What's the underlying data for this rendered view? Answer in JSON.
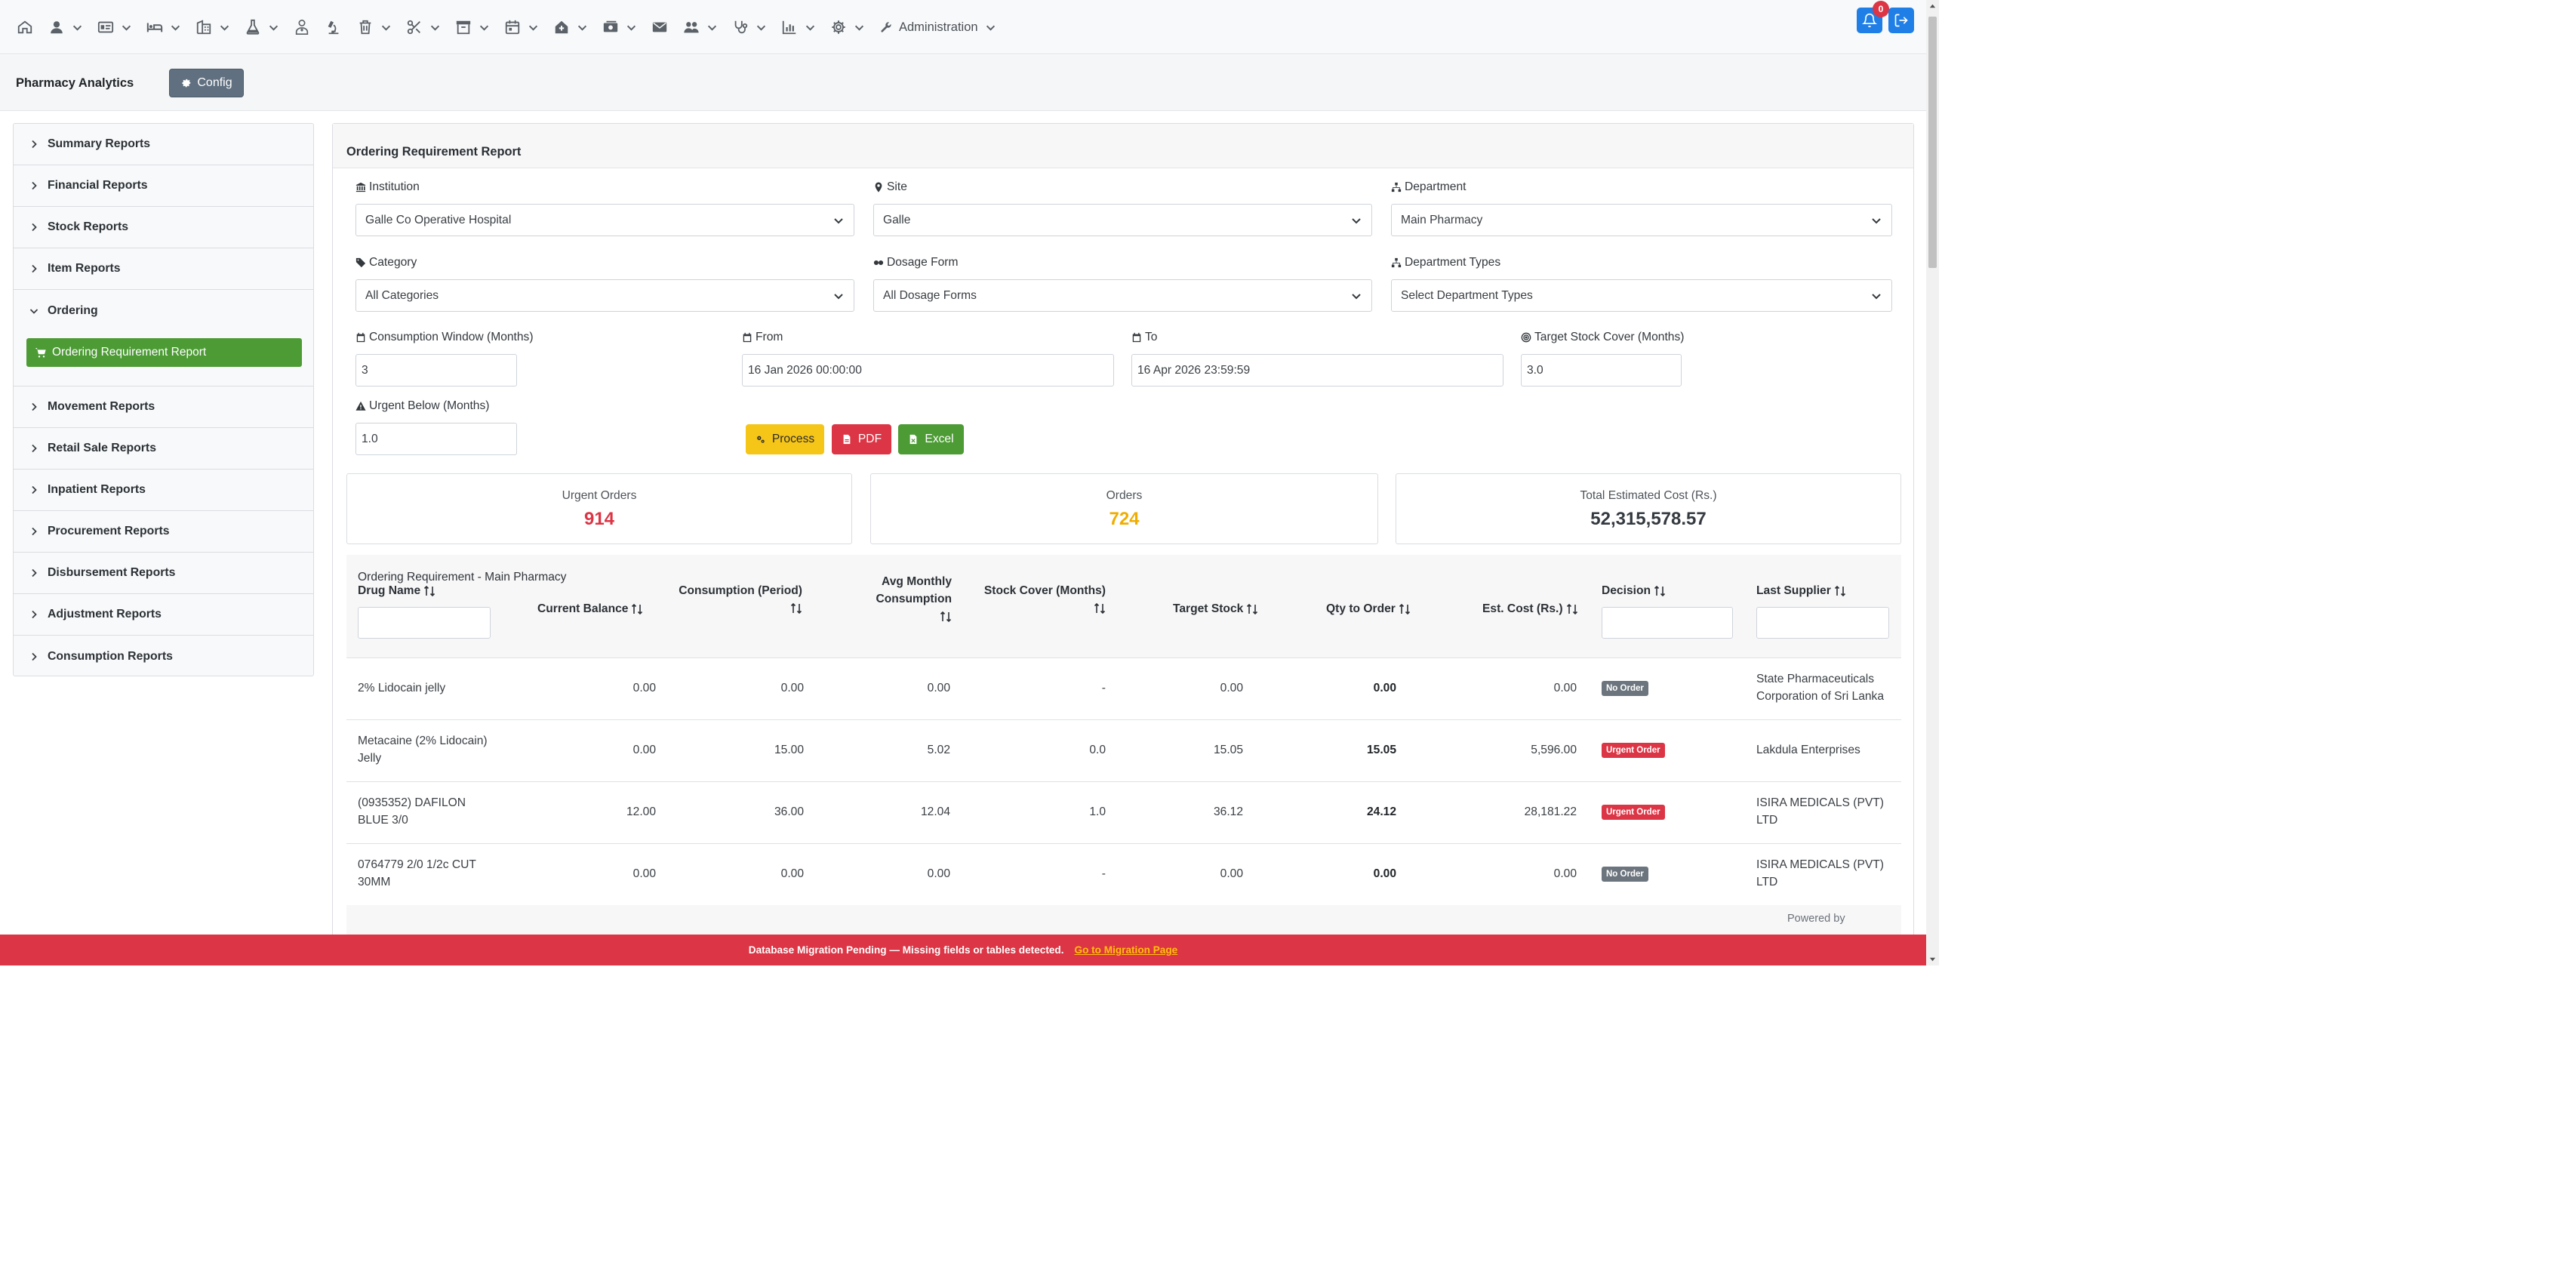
{
  "navbar": {
    "items": [
      {
        "icon": "home-icon",
        "dropdown": false
      },
      {
        "icon": "user-icon",
        "dropdown": true
      },
      {
        "icon": "id-card-icon",
        "dropdown": true
      },
      {
        "icon": "bed-icon",
        "dropdown": true
      },
      {
        "icon": "building-icon",
        "dropdown": true
      },
      {
        "icon": "flask-icon",
        "dropdown": true
      },
      {
        "icon": "doctor-icon",
        "dropdown": false
      },
      {
        "icon": "microscope-icon",
        "dropdown": false
      },
      {
        "icon": "trash-icon",
        "dropdown": true
      },
      {
        "icon": "scissors-icon",
        "dropdown": true
      },
      {
        "icon": "archive-icon",
        "dropdown": true
      },
      {
        "icon": "calendar-icon",
        "dropdown": true
      },
      {
        "icon": "house-medical-icon",
        "dropdown": true
      },
      {
        "icon": "money-icon",
        "dropdown": true
      },
      {
        "icon": "envelope-icon",
        "dropdown": false
      },
      {
        "icon": "users-icon",
        "dropdown": true
      },
      {
        "icon": "stethoscope-icon",
        "dropdown": true
      },
      {
        "icon": "chart-icon",
        "dropdown": true
      },
      {
        "icon": "gear-icon",
        "dropdown": true
      }
    ],
    "admin_label": "Administration",
    "notification_count": "0"
  },
  "subheader": {
    "title": "Pharmacy Analytics",
    "config_label": "Config"
  },
  "sidebar": {
    "items": [
      {
        "label": "Summary Reports"
      },
      {
        "label": "Financial Reports"
      },
      {
        "label": "Stock Reports"
      },
      {
        "label": "Item Reports"
      },
      {
        "label": "Ordering",
        "open": true
      },
      {
        "label": "Movement Reports"
      },
      {
        "label": "Retail Sale Reports"
      },
      {
        "label": "Inpatient Reports"
      },
      {
        "label": "Procurement Reports"
      },
      {
        "label": "Disbursement Reports"
      },
      {
        "label": "Adjustment Reports"
      },
      {
        "label": "Consumption Reports"
      }
    ],
    "active_sub_label": "Ordering Requirement Report"
  },
  "main": {
    "title": "Ordering Requirement Report",
    "filters": {
      "institution_label": "Institution",
      "institution_value": "Galle Co Operative Hospital",
      "site_label": "Site",
      "site_value": "Galle",
      "department_label": "Department",
      "department_value": "Main Pharmacy",
      "category_label": "Category",
      "category_value": "All Categories",
      "dosage_label": "Dosage Form",
      "dosage_value": "All Dosage Forms",
      "dept_types_label": "Department Types",
      "dept_types_value": "Select Department Types",
      "consumption_label": "Consumption Window (Months)",
      "consumption_value": "3",
      "from_label": "From",
      "from_value": "16 Jan 2026 00:00:00",
      "to_label": "To",
      "to_value": "16 Apr 2026 23:59:59",
      "target_label": "Target Stock Cover (Months)",
      "target_value": "3.0",
      "urgent_label": "Urgent Below (Months)",
      "urgent_value": "1.0"
    },
    "buttons": {
      "process": "Process",
      "pdf": "PDF",
      "excel": "Excel"
    },
    "stats": {
      "urgent_label": "Urgent Orders",
      "urgent_value": "914",
      "orders_label": "Orders",
      "orders_value": "724",
      "cost_label": "Total Estimated Cost (Rs.)",
      "cost_value": "52,315,578.57"
    },
    "table": {
      "title": "Ordering Requirement - Main Pharmacy",
      "headers": {
        "drug_name": "Drug Name",
        "current_balance": "Current Balance",
        "consumption_1": "Consumption (Period)",
        "avg_1": "Avg Monthly",
        "avg_2": "Consumption",
        "stock_cover": "Stock Cover (Months)",
        "target_stock": "Target Stock",
        "qty_to_order": "Qty to Order",
        "est_cost": "Est. Cost (Rs.)",
        "decision": "Decision",
        "last_supplier": "Last Supplier"
      },
      "rows": [
        {
          "drug_1": "2% Lidocain jelly",
          "drug_2": "",
          "balance": "0.00",
          "consumption": "0.00",
          "avg": "0.00",
          "cover": "-",
          "target": "0.00",
          "qty": "0.00",
          "cost": "0.00",
          "decision": "No Order",
          "decision_color": "#6c757d",
          "supplier_1": "State Pharmaceuticals",
          "supplier_2": "Corporation of Sri Lanka"
        },
        {
          "drug_1": "Metacaine (2% Lidocain)",
          "drug_2": "Jelly",
          "balance": "0.00",
          "consumption": "15.00",
          "avg": "5.02",
          "cover": "0.0",
          "target": "15.05",
          "qty": "15.05",
          "cost": "5,596.00",
          "decision": "Urgent Order",
          "decision_color": "#dc3545",
          "supplier_1": "Lakdula Enterprises",
          "supplier_2": ""
        },
        {
          "drug_1": "(0935352) DAFILON",
          "drug_2": "BLUE 3/0",
          "balance": "12.00",
          "consumption": "36.00",
          "avg": "12.04",
          "cover": "1.0",
          "target": "36.12",
          "qty": "24.12",
          "cost": "28,181.22",
          "decision": "Urgent Order",
          "decision_color": "#dc3545",
          "supplier_1": "ISIRA MEDICALS (PVT)",
          "supplier_2": "LTD"
        },
        {
          "drug_1": "0764779 2/0 1/2c CUT",
          "drug_2": "30MM",
          "balance": "0.00",
          "consumption": "0.00",
          "avg": "0.00",
          "cover": "-",
          "target": "0.00",
          "qty": "0.00",
          "cost": "0.00",
          "decision": "No Order",
          "decision_color": "#6c757d",
          "supplier_1": "ISIRA MEDICALS (PVT)",
          "supplier_2": "LTD"
        }
      ]
    },
    "powered_by": "Powered by"
  },
  "banner": {
    "message": "Database Migration Pending — Missing fields or tables detected.",
    "link": "Go to Migration Page"
  },
  "colors": {
    "primary": "#1f7fe6",
    "success": "#4c9b34",
    "danger": "#dc3545",
    "warning": "#ffc107",
    "secondary": "#6c757d"
  }
}
